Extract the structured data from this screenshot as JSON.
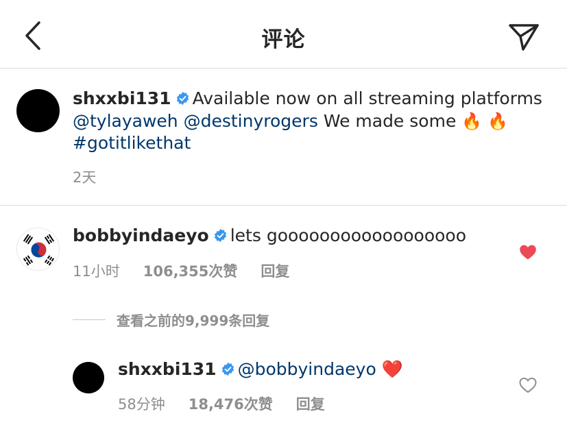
{
  "header": {
    "title": "评论",
    "back_icon": "chevron-left-icon",
    "send_icon": "paper-plane-icon"
  },
  "caption": {
    "username": "shxxbi131",
    "text": "Available now on all streaming platforms",
    "mention_1": "@tylayaweh",
    "mention_2": "@destinyrogers",
    "text_2": "We made some",
    "emoji": "🔥",
    "hashtag": "#gotitlikethat",
    "time": "2天"
  },
  "comments": [
    {
      "username": "bobbyindaeyo",
      "text": "lets goooooooooooooooooo",
      "time": "11小时",
      "likes": "106,355次赞",
      "reply": "回复",
      "liked": true
    }
  ],
  "view_replies": "查看之前的9,999条回复",
  "reply": {
    "username": "shxxbi131",
    "mention": "@bobbyindaeyo",
    "emoji": "❤️",
    "time": "58分钟",
    "likes": "18,476次赞",
    "reply": "回复",
    "liked": false
  },
  "colors": {
    "like_red": "#ed4956",
    "verified_blue": "#3897f0",
    "mention_blue": "#00376b",
    "secondary_text": "#8e8e8e"
  }
}
